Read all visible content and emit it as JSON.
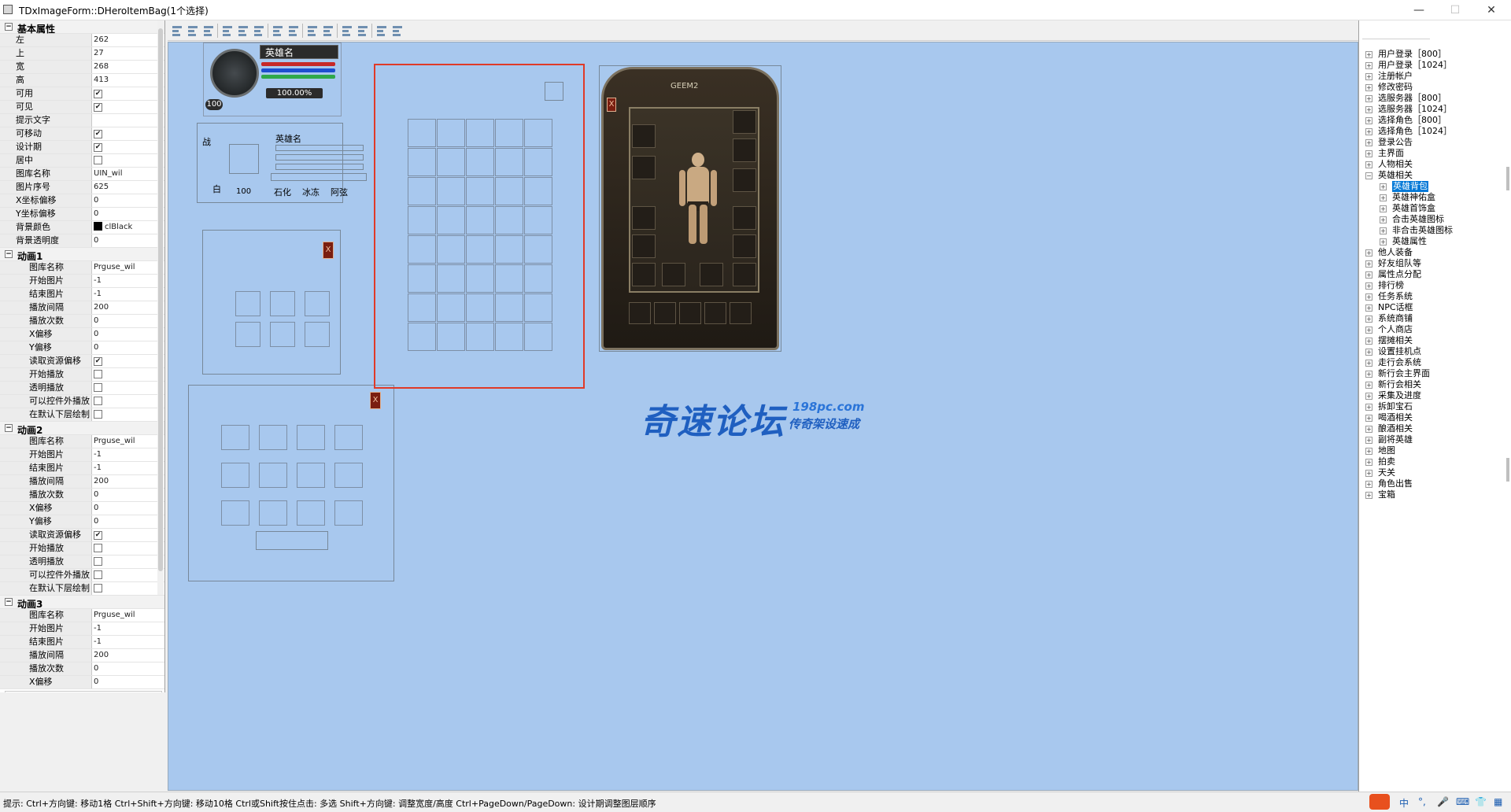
{
  "window": {
    "title": "TDxImageForm::DHeroItemBag(1个选择)",
    "min": "—",
    "max": "☐",
    "close": "✕"
  },
  "props": {
    "basic": {
      "title": "基本属性",
      "rows": [
        {
          "name": "左",
          "value": "262"
        },
        {
          "name": "上",
          "value": "27"
        },
        {
          "name": "宽",
          "value": "268"
        },
        {
          "name": "高",
          "value": "413"
        },
        {
          "name": "可用",
          "check": true
        },
        {
          "name": "可见",
          "check": true
        },
        {
          "name": "提示文字",
          "value": ""
        },
        {
          "name": "可移动",
          "check": true
        },
        {
          "name": "设计期",
          "check": true
        },
        {
          "name": "居中",
          "check": false
        },
        {
          "name": "图库名称",
          "value": "UIN_wil"
        },
        {
          "name": "图片序号",
          "value": "625"
        },
        {
          "name": "X坐标偏移",
          "value": "0"
        },
        {
          "name": "Y坐标偏移",
          "value": "0"
        },
        {
          "name": "背景颜色",
          "value": "clBlack",
          "swatch": "#000000"
        },
        {
          "name": "背景透明度",
          "value": "0"
        }
      ]
    },
    "anim1": {
      "title": "动画1",
      "rows": [
        {
          "name": "图库名称",
          "value": "Prguse_wil"
        },
        {
          "name": "开始图片",
          "value": "-1"
        },
        {
          "name": "结束图片",
          "value": "-1"
        },
        {
          "name": "播放间隔",
          "value": "200"
        },
        {
          "name": "播放次数",
          "value": "0"
        },
        {
          "name": "X偏移",
          "value": "0"
        },
        {
          "name": "Y偏移",
          "value": "0"
        },
        {
          "name": "读取资源偏移",
          "check": true
        },
        {
          "name": "开始播放",
          "check": false
        },
        {
          "name": "透明播放",
          "check": false
        },
        {
          "name": "可以控件外播放",
          "check": false
        },
        {
          "name": "在默认下层绘制",
          "check": false
        }
      ]
    },
    "anim2": {
      "title": "动画2",
      "rows": [
        {
          "name": "图库名称",
          "value": "Prguse_wil"
        },
        {
          "name": "开始图片",
          "value": "-1"
        },
        {
          "name": "结束图片",
          "value": "-1"
        },
        {
          "name": "播放间隔",
          "value": "200"
        },
        {
          "name": "播放次数",
          "value": "0"
        },
        {
          "name": "X偏移",
          "value": "0"
        },
        {
          "name": "Y偏移",
          "value": "0"
        },
        {
          "name": "读取资源偏移",
          "check": true
        },
        {
          "name": "开始播放",
          "check": false
        },
        {
          "name": "透明播放",
          "check": false
        },
        {
          "name": "可以控件外播放",
          "check": false
        },
        {
          "name": "在默认下层绘制",
          "check": false
        }
      ]
    },
    "anim3": {
      "title": "动画3",
      "rows": [
        {
          "name": "图库名称",
          "value": "Prguse_wil"
        },
        {
          "name": "开始图片",
          "value": "-1"
        },
        {
          "name": "结束图片",
          "value": "-1"
        },
        {
          "name": "播放间隔",
          "value": "200"
        },
        {
          "name": "播放次数",
          "value": "0"
        },
        {
          "name": "X偏移",
          "value": "0"
        }
      ]
    }
  },
  "canvas": {
    "hero_name_top": "英雄名",
    "level": "100",
    "exp_percent": "100.00%",
    "hero_name_info": "英雄名",
    "info_left_top": "战",
    "info_left_bottom": "白",
    "info_num": "100",
    "info_labels": [
      "石化",
      "冰冻",
      "阿弦"
    ],
    "equip_title": "GEEM2",
    "close_glyph": "X",
    "watermark_main": "奇速论坛",
    "watermark_url": "198pc.com",
    "watermark_sub": "传奇架设速成"
  },
  "tree": {
    "items": [
      {
        "label": "用户登录［800］",
        "expanded": false,
        "level": 0
      },
      {
        "label": "用户登录［1024］",
        "expanded": false,
        "level": 0
      },
      {
        "label": "注册帐户",
        "expanded": false,
        "level": 0
      },
      {
        "label": "修改密码",
        "expanded": false,
        "level": 0
      },
      {
        "label": "选服务器［800］",
        "expanded": false,
        "level": 0
      },
      {
        "label": "选服务器［1024］",
        "expanded": false,
        "level": 0
      },
      {
        "label": "选择角色［800］",
        "expanded": false,
        "level": 0
      },
      {
        "label": "选择角色［1024］",
        "expanded": false,
        "level": 0
      },
      {
        "label": "登录公告",
        "expanded": false,
        "level": 0
      },
      {
        "label": "主界面",
        "expanded": false,
        "level": 0
      },
      {
        "label": "人物相关",
        "expanded": false,
        "level": 0
      },
      {
        "label": "英雄相关",
        "expanded": true,
        "level": 0
      },
      {
        "label": "英雄背包",
        "expanded": false,
        "level": 1,
        "selected": true
      },
      {
        "label": "英雄神佑盒",
        "expanded": false,
        "level": 1
      },
      {
        "label": "英雄首饰盒",
        "expanded": false,
        "level": 1
      },
      {
        "label": "合击英雄图标",
        "expanded": false,
        "level": 1
      },
      {
        "label": "非合击英雄图标",
        "expanded": false,
        "level": 1
      },
      {
        "label": "英雄属性",
        "expanded": false,
        "level": 1
      },
      {
        "label": "他人装备",
        "expanded": false,
        "level": 0
      },
      {
        "label": "好友组队等",
        "expanded": false,
        "level": 0
      },
      {
        "label": "属性点分配",
        "expanded": false,
        "level": 0
      },
      {
        "label": "排行榜",
        "expanded": false,
        "level": 0
      },
      {
        "label": "任务系统",
        "expanded": false,
        "level": 0
      },
      {
        "label": "NPC话框",
        "expanded": false,
        "level": 0
      },
      {
        "label": "系统商铺",
        "expanded": false,
        "level": 0
      },
      {
        "label": "个人商店",
        "expanded": false,
        "level": 0
      },
      {
        "label": "摆摊相关",
        "expanded": false,
        "level": 0
      },
      {
        "label": "设置挂机点",
        "expanded": false,
        "level": 0
      },
      {
        "label": "走行会系统",
        "expanded": false,
        "level": 0
      },
      {
        "label": "新行会主界面",
        "expanded": false,
        "level": 0
      },
      {
        "label": "新行会相关",
        "expanded": false,
        "level": 0
      },
      {
        "label": "采集及进度",
        "expanded": false,
        "level": 0
      },
      {
        "label": "拆卸宝石",
        "expanded": false,
        "level": 0
      },
      {
        "label": "喝酒相关",
        "expanded": false,
        "level": 0
      },
      {
        "label": "酿酒相关",
        "expanded": false,
        "level": 0
      },
      {
        "label": "副将英雄",
        "expanded": false,
        "level": 0
      },
      {
        "label": "地图",
        "expanded": false,
        "level": 0
      },
      {
        "label": "拍卖",
        "expanded": false,
        "level": 0
      },
      {
        "label": "天关",
        "expanded": false,
        "level": 0
      },
      {
        "label": "角色出售",
        "expanded": false,
        "level": 0
      },
      {
        "label": "宝箱",
        "expanded": false,
        "level": 0
      }
    ]
  },
  "status": {
    "text": "提示:  Ctrl+方向键: 移动1格    Ctrl+Shift+方向键: 移动10格    Ctrl或Shift按住点击: 多选    Shift+方向键: 调整宽度/高度    Ctrl+PageDown/PageDown: 设计期调整图层顺序",
    "tray": [
      "中",
      "°,",
      "🎤",
      "⌨",
      "👕",
      "▦"
    ]
  },
  "colors": {
    "canvas_bg": "#a8c8ee",
    "selection_border": "#e03a28",
    "watermark": "#1f5fc0"
  },
  "icons": [
    "window-app-icon",
    "minimize-icon",
    "maximize-icon",
    "close-icon",
    "align-icon",
    "expand-icon",
    "collapse-icon",
    "ime-icon"
  ]
}
